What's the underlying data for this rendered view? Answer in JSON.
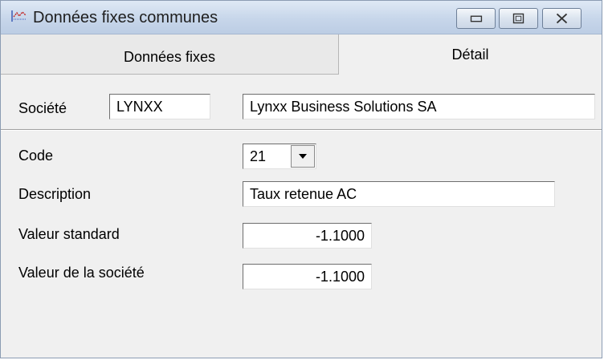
{
  "window": {
    "title": "Données fixes communes",
    "icon": "app-chart-icon",
    "controls": [
      "minimize-icon",
      "maximize-icon",
      "close-icon"
    ]
  },
  "tabs": [
    {
      "label": "Données fixes",
      "active": false
    },
    {
      "label": "Détail",
      "active": true
    }
  ],
  "company": {
    "label": "Société",
    "code": "LYNXX",
    "name": "Lynxx Business Solutions SA"
  },
  "form": {
    "code_label": "Code",
    "code_value": "21",
    "description_label": "Description",
    "description_value": "Taux retenue AC",
    "standard_label": "Valeur standard",
    "standard_value": "-1.1000",
    "company_value_label": "Valeur de la société",
    "company_value": "-1.1000"
  }
}
